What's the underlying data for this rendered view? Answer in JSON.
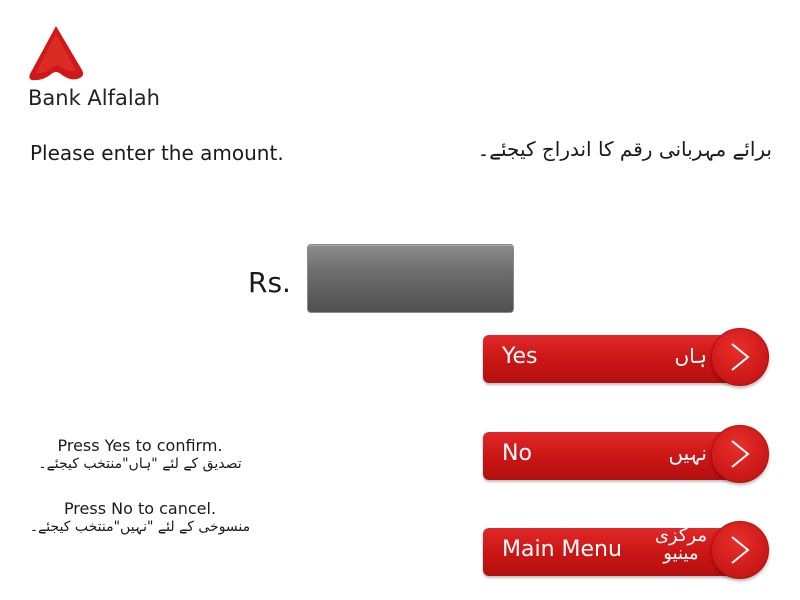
{
  "brand": {
    "name": "Bank Alfalah",
    "accent_color": "#d0181b"
  },
  "prompt": {
    "english": "Please enter the amount.",
    "urdu": "برائے مہربانی رقم کا اندراج کیجئے۔"
  },
  "amount": {
    "currency_label": "Rs.",
    "value": ""
  },
  "buttons": {
    "yes": {
      "english": "Yes",
      "urdu": "ہاں"
    },
    "no": {
      "english": "No",
      "urdu": "نہیں"
    },
    "main_menu": {
      "english": "Main Menu",
      "urdu_line1": "مرکزی",
      "urdu_line2": "مینیو"
    }
  },
  "hints": {
    "yes_en": "Press Yes to confirm.",
    "yes_ur": "تصدیق کے لئے \"ہاں\"منتخب کیجئے۔",
    "no_en": "Press No to cancel.",
    "no_ur": "منسوخی کے لئے \"نہیں\"منتخب کیجئے۔"
  },
  "icons": {
    "logo": "bank-alfalah-logo-icon",
    "chevron": "chevron-right-icon"
  }
}
